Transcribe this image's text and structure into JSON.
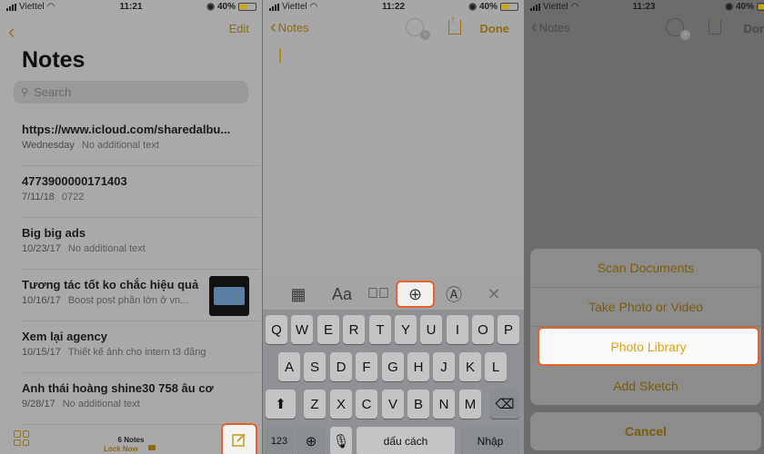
{
  "colors": {
    "accent": "#e0a800",
    "highlight": "#e8622c"
  },
  "screens": [
    {
      "status": {
        "carrier": "Viettel",
        "time": "11:21",
        "battery": "40%"
      },
      "nav": {
        "back_icon": "chevron-left",
        "edit_label": "Edit"
      },
      "title": "Notes",
      "search": {
        "placeholder": "Search"
      },
      "notes": [
        {
          "title": "https://www.icloud.com/sharedalbu...",
          "date": "Wednesday",
          "snippet": "No additional text"
        },
        {
          "title": "4773900000171403",
          "date": "7/11/18",
          "snippet": "0722"
        },
        {
          "title": "Big big ads",
          "date": "10/23/17",
          "snippet": "No additional text"
        },
        {
          "title": "Tương tác tốt ko chắc hiệu quả",
          "date": "10/16/17",
          "snippet": "Boost post phần lớn ở vn...",
          "has_thumbnail": true
        },
        {
          "title": "Xem lại agency",
          "date": "10/15/17",
          "snippet": "Thiết kế ảnh cho intern t3 đăng"
        },
        {
          "title": "Anh thái hoàng shine30 758 âu cơ",
          "date": "9/28/17",
          "snippet": "No additional text"
        }
      ],
      "footer": {
        "count": "6 Notes",
        "lock_label": "Lock Now"
      }
    },
    {
      "status": {
        "carrier": "Viettel",
        "time": "11:22",
        "battery": "40%"
      },
      "nav": {
        "back_label": "Notes",
        "done_label": "Done"
      },
      "toolbar": {
        "table": "table-icon",
        "format": "Aa",
        "checklist": "checklist-icon",
        "add": "add-icon",
        "sketch": "sketch-icon",
        "close": "close-icon"
      },
      "keyboard": {
        "row1": [
          "Q",
          "W",
          "E",
          "R",
          "T",
          "Y",
          "U",
          "I",
          "O",
          "P"
        ],
        "row2": [
          "A",
          "S",
          "D",
          "F",
          "G",
          "H",
          "J",
          "K",
          "L"
        ],
        "row3": [
          "Z",
          "X",
          "C",
          "V",
          "B",
          "N",
          "M"
        ],
        "numbers": "123",
        "space": "dấu cách",
        "return": "Nhập"
      }
    },
    {
      "status": {
        "carrier": "Viettel",
        "time": "11:23",
        "battery": "40%"
      },
      "nav": {
        "back_label": "Notes",
        "done_label": "Done"
      },
      "action_sheet": {
        "items": [
          "Scan Documents",
          "Take Photo or Video",
          "Photo Library",
          "Add Sketch"
        ],
        "selected": "Photo Library",
        "cancel": "Cancel"
      }
    }
  ]
}
